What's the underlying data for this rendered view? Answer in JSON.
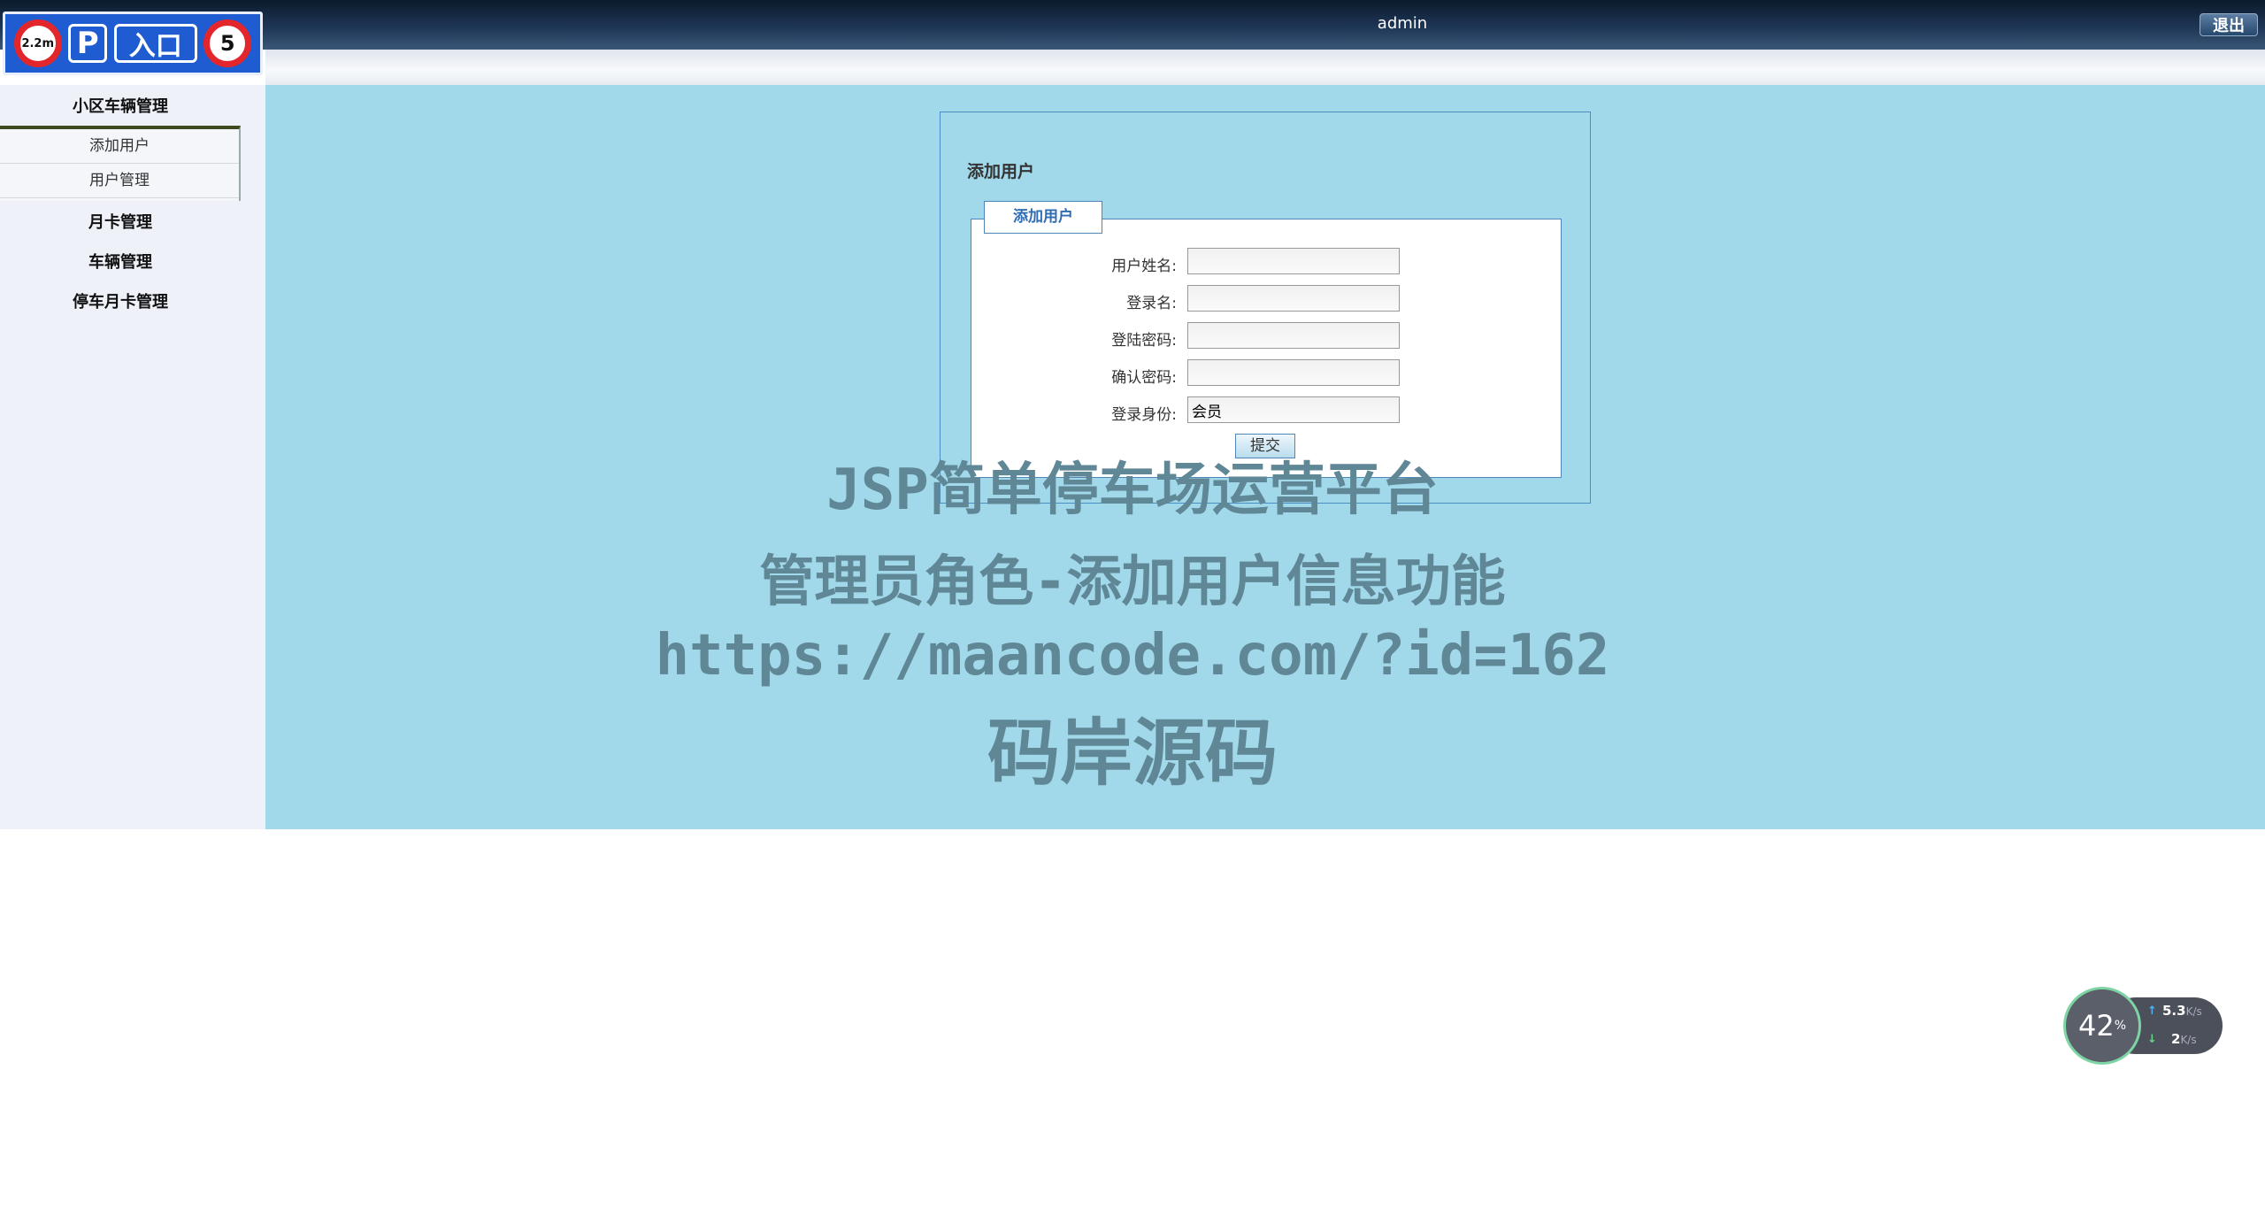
{
  "header": {
    "logo": {
      "height_sign": "2.2m",
      "parking_letter": "P",
      "entrance_text": "入口",
      "speed_limit": "5"
    },
    "user": "admin",
    "logout_label": "退出"
  },
  "sidebar": {
    "groups": [
      {
        "label": "小区车辆管理"
      },
      {
        "label": "月卡管理"
      },
      {
        "label": "车辆管理"
      },
      {
        "label": "停车月卡管理"
      }
    ],
    "sub_items": [
      {
        "label": "添加用户"
      },
      {
        "label": "用户管理"
      }
    ]
  },
  "form": {
    "title": "添加用户",
    "legend": "添加用户",
    "fields": [
      {
        "label": "用户姓名:",
        "value": ""
      },
      {
        "label": "登录名:",
        "value": ""
      },
      {
        "label": "登陆密码:",
        "value": ""
      },
      {
        "label": "确认密码:",
        "value": ""
      },
      {
        "label": "登录身份:",
        "value": "会员"
      }
    ],
    "submit_label": "提交"
  },
  "watermark": {
    "line1": "JSP简单停车场运营平台",
    "line2": "管理员角色-添加用户信息功能",
    "line3": "https://maancode.com/?id=162",
    "line4": "码岸源码"
  },
  "net_widget": {
    "percent": "42",
    "percent_unit": "%",
    "up_value": "5.3",
    "up_unit": "K/s",
    "down_value": "2",
    "down_unit": "K/s"
  }
}
